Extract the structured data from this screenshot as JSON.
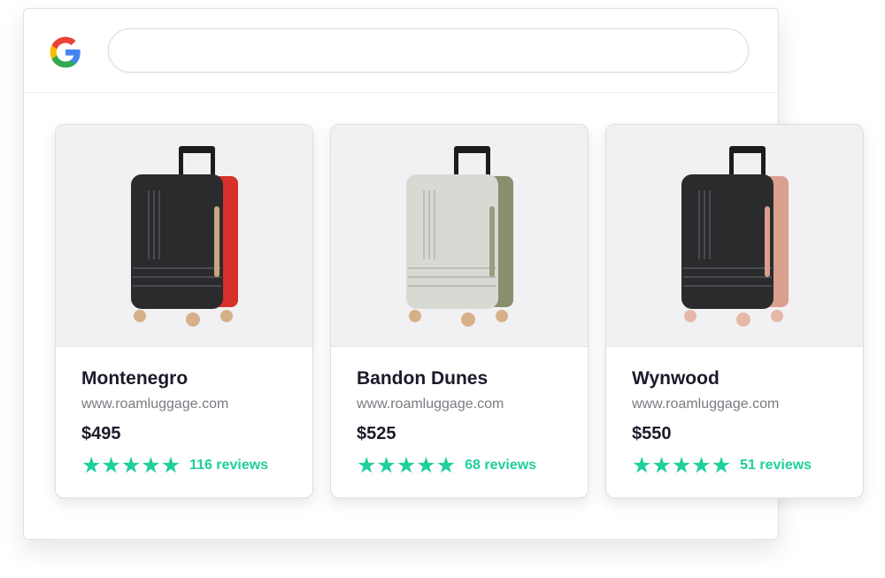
{
  "search": {
    "value": "",
    "placeholder": ""
  },
  "products": [
    {
      "name": "Montenegro",
      "url": "www.roamluggage.com",
      "price": "$495",
      "reviews": "116 reviews",
      "rating": 5,
      "body_color": "#2a2b2d",
      "accent_color": "#d8312b"
    },
    {
      "name": "Bandon Dunes",
      "url": "www.roamluggage.com",
      "price": "$525",
      "reviews": "68 reviews",
      "rating": 5,
      "body_color": "#d9d9d4",
      "accent_color": "#8b8e6d"
    },
    {
      "name": "Wynwood",
      "url": "www.roamluggage.com",
      "price": "$550",
      "reviews": "51 reviews",
      "rating": 5,
      "body_color": "#2a2b2d",
      "accent_color": "#d9a08e"
    }
  ],
  "colors": {
    "star": "#1fcf9c",
    "text": "#1b1b2a",
    "muted": "#7b7b82"
  },
  "icons": {
    "logo": "google-g-icon",
    "star": "star-icon"
  }
}
